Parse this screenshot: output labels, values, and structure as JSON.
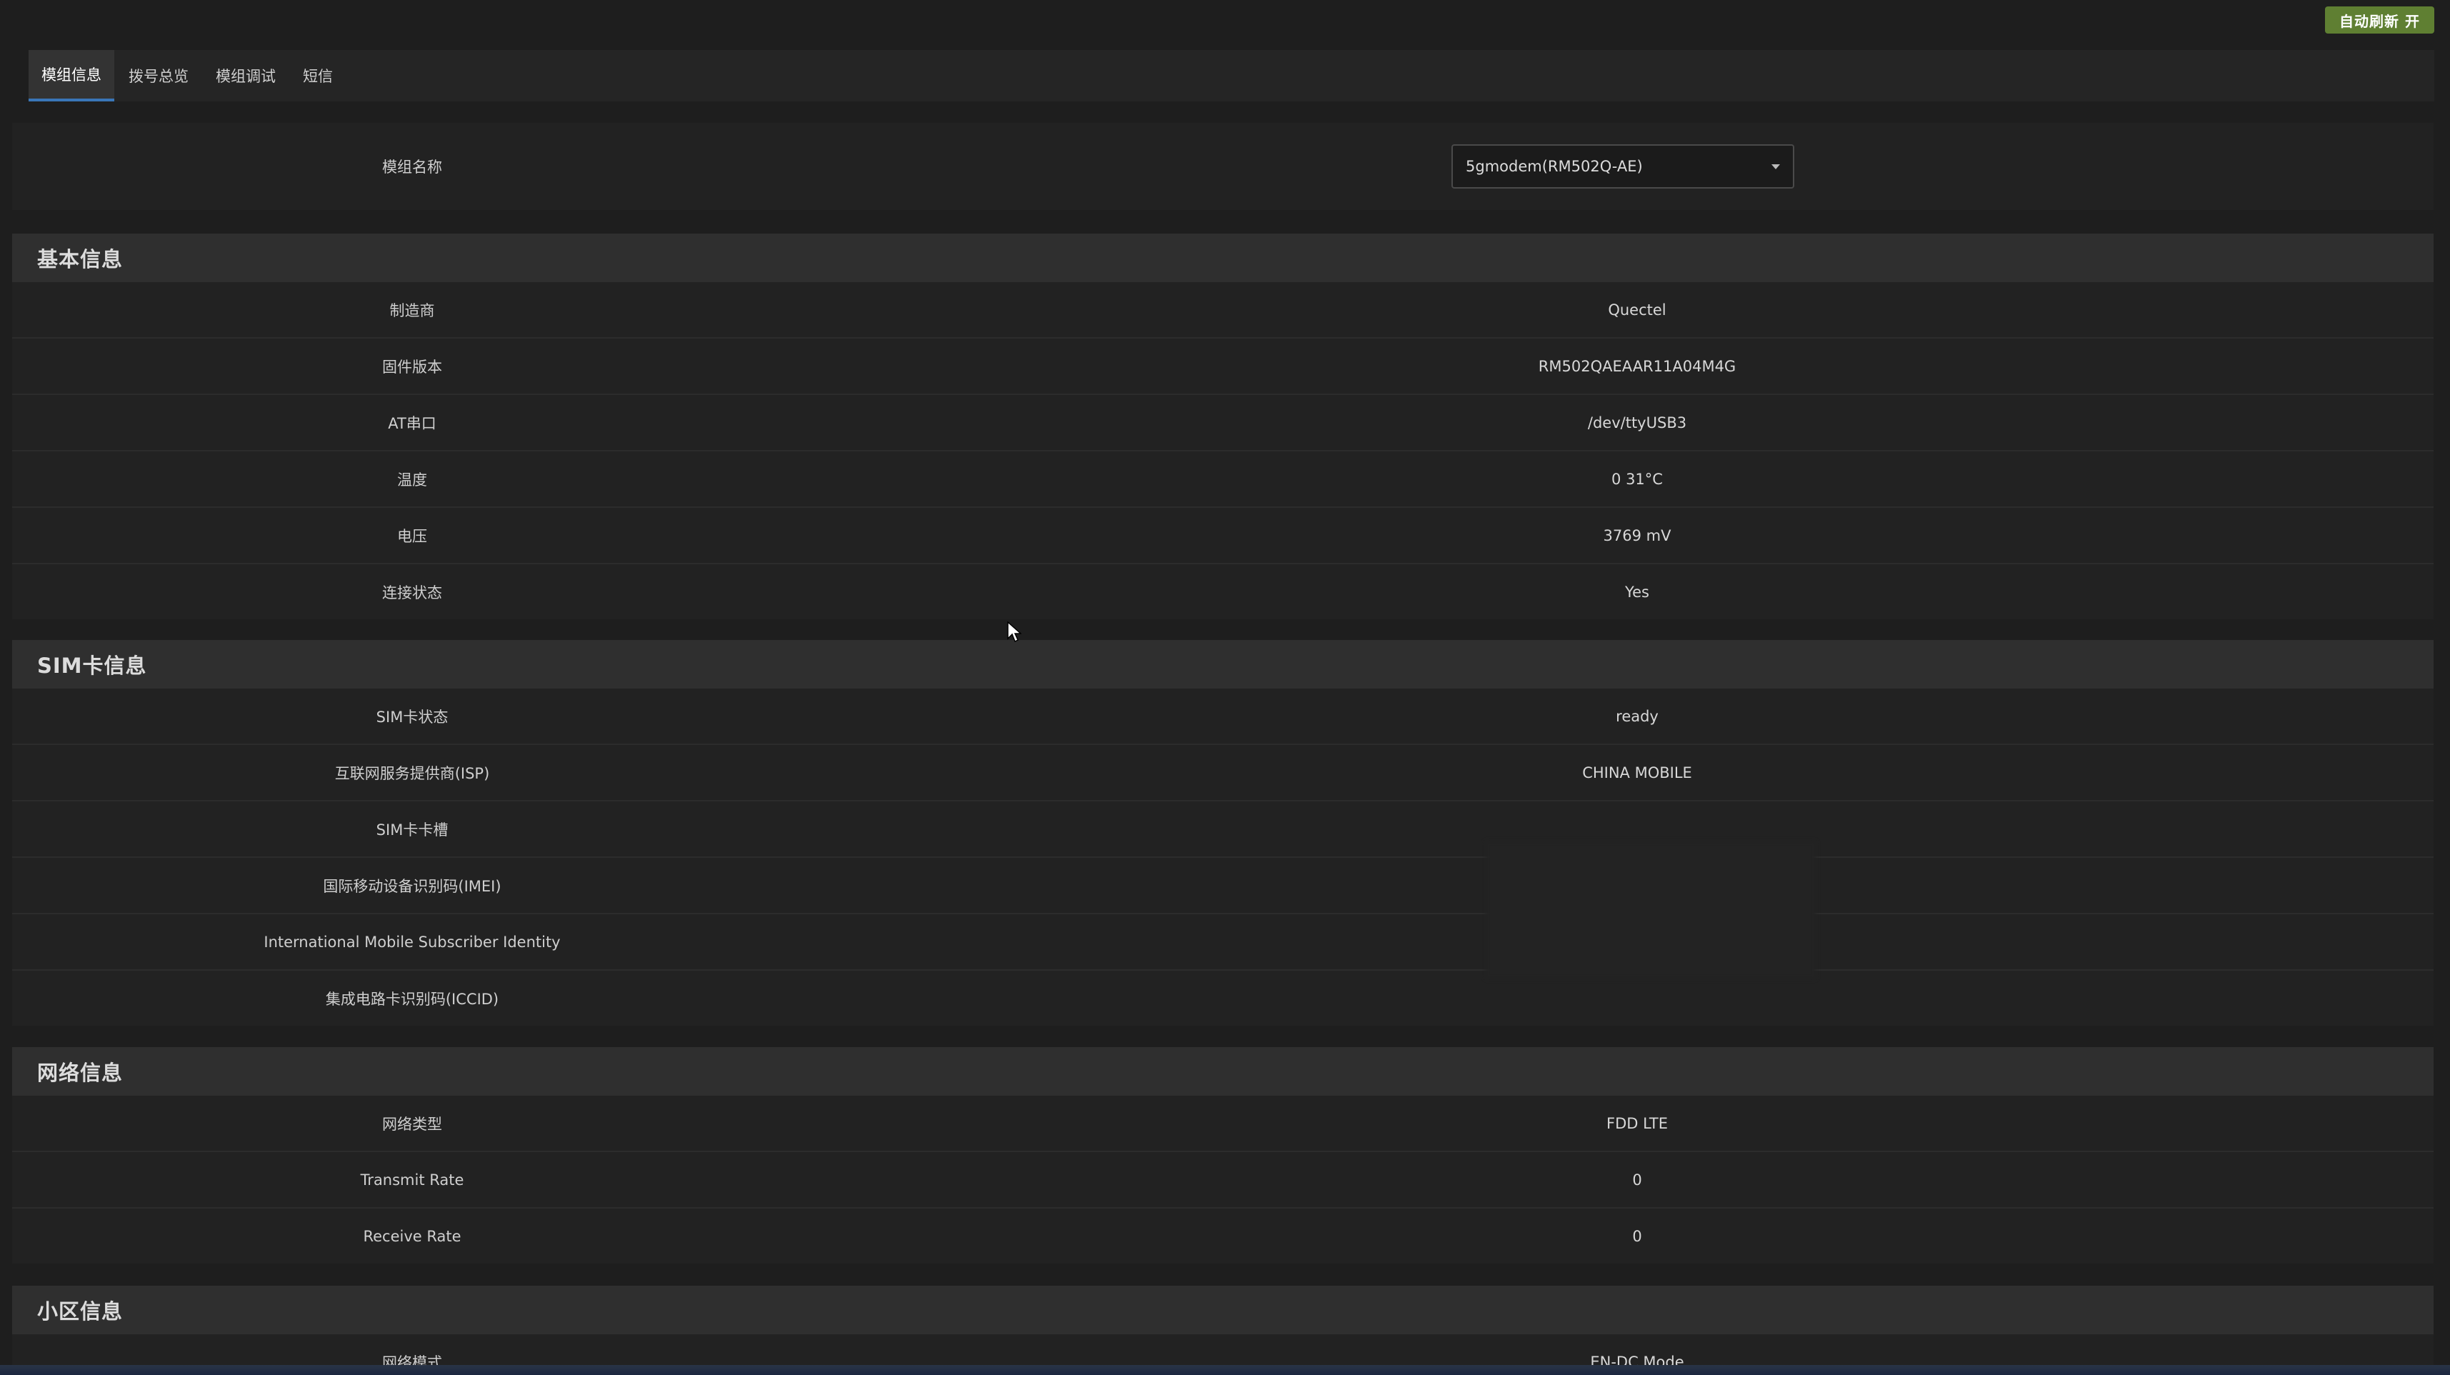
{
  "header": {
    "auto_refresh": "自动刷新 开"
  },
  "tabs": [
    {
      "label": "模组信息",
      "active": true
    },
    {
      "label": "拨号总览",
      "active": false
    },
    {
      "label": "模组调试",
      "active": false
    },
    {
      "label": "短信",
      "active": false
    }
  ],
  "module_select": {
    "label": "模组名称",
    "value": "5gmodem(RM502Q-AE)"
  },
  "basic_info": {
    "title": "基本信息",
    "rows": [
      {
        "label": "制造商",
        "value": "Quectel"
      },
      {
        "label": "固件版本",
        "value": "RM502QAEAAR11A04M4G"
      },
      {
        "label": "AT串口",
        "value": "/dev/ttyUSB3"
      },
      {
        "label": "温度",
        "value": "0 31°C"
      },
      {
        "label": "电压",
        "value": "3769 mV"
      },
      {
        "label": "连接状态",
        "value": "Yes"
      }
    ]
  },
  "sim_info": {
    "title": "SIM卡信息",
    "rows": [
      {
        "label": "SIM卡状态",
        "value": "ready"
      },
      {
        "label": "互联网服务提供商(ISP)",
        "value": "CHINA MOBILE"
      },
      {
        "label": "SIM卡卡槽",
        "value": ""
      },
      {
        "label": "国际移动设备识别码(IMEI)",
        "value": ""
      },
      {
        "label": "International Mobile Subscriber Identity",
        "value": ""
      },
      {
        "label": "集成电路卡识别码(ICCID)",
        "value": ""
      }
    ]
  },
  "network_info": {
    "title": "网络信息",
    "rows": [
      {
        "label": "网络类型",
        "value": "FDD LTE"
      },
      {
        "label": "Transmit Rate",
        "value": "0"
      },
      {
        "label": "Receive Rate",
        "value": "0"
      }
    ]
  },
  "cell_info": {
    "title": "小区信息",
    "rows": [
      {
        "label": "网络模式",
        "value": "EN-DC Mode"
      }
    ]
  },
  "colors": {
    "background": "#1e1e1e",
    "panel": "#222222",
    "section_header": "#2f2f2f",
    "auto_refresh_button": "#5f7f32",
    "active_tab_underline": "#3a76b8"
  },
  "icons": [
    "chevron-down-icon",
    "mouse-cursor-icon"
  ]
}
